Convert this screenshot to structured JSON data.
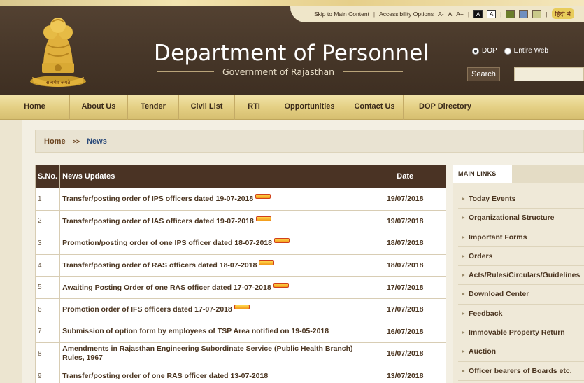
{
  "utility": {
    "skip_link": "Skip to Main Content",
    "accessibility": "Accessibility Options",
    "font_small": "A-",
    "font_normal": "A",
    "font_large": "A+",
    "contrast_dark": "A",
    "contrast_light": "A",
    "swatches": [
      "#6b7d2a",
      "#6f8fbf",
      "#c9c98a"
    ],
    "hindi": "हिंदी में"
  },
  "header": {
    "title": "Department of Personnel",
    "subtitle": "Government of Rajasthan",
    "emblem_motto": "सत्यमेव जयते"
  },
  "search": {
    "option_dop": "DOP",
    "option_web": "Entire Web",
    "button": "Search",
    "value": ""
  },
  "nav": [
    {
      "label": "Home"
    },
    {
      "label": "About Us"
    },
    {
      "label": "Tender"
    },
    {
      "label": "Civil List"
    },
    {
      "label": "RTI"
    },
    {
      "label": "Opportunities"
    },
    {
      "label": "Contact Us"
    },
    {
      "label": "DOP Directory"
    }
  ],
  "breadcrumb": {
    "home": "Home",
    "sep": ">>",
    "current": "News"
  },
  "table": {
    "headers": {
      "sno": "S.No.",
      "title": "News Updates",
      "date": "Date"
    },
    "rows": [
      {
        "sno": "1",
        "title": "Transfer/posting order of IPS officers dated 19-07-2018",
        "date": "19/07/2018",
        "new": true
      },
      {
        "sno": "2",
        "title": "Transfer/posting order of IAS officers dated 19-07-2018",
        "date": "19/07/2018",
        "new": true
      },
      {
        "sno": "3",
        "title": "Promotion/posting order of one IPS officer dated 18-07-2018",
        "date": "18/07/2018",
        "new": true
      },
      {
        "sno": "4",
        "title": "Transfer/posting order of RAS officers dated 18-07-2018",
        "date": "18/07/2018",
        "new": true
      },
      {
        "sno": "5",
        "title": "Awaiting Posting Order of one RAS officer dated 17-07-2018",
        "date": "17/07/2018",
        "new": true
      },
      {
        "sno": "6",
        "title": "Promotion order of IFS officers dated 17-07-2018",
        "date": "17/07/2018",
        "new": true
      },
      {
        "sno": "7",
        "title": "Submission of option form by employees of TSP Area notified on 19-05-2018",
        "date": "16/07/2018",
        "new": false
      },
      {
        "sno": "8",
        "title": "Amendments in Rajasthan Engineering Subordinate Service (Public Health Branch) Rules, 1967",
        "date": "16/07/2018",
        "new": false
      },
      {
        "sno": "9",
        "title": "Transfer/posting order of one RAS officer dated 13-07-2018",
        "date": "13/07/2018",
        "new": false
      }
    ]
  },
  "side": {
    "tab": "MAIN LINKS",
    "links": [
      "Today Events",
      "Organizational Structure",
      "Important Forms",
      "Orders",
      "Acts/Rules/Circulars/Guidelines",
      "Download Center",
      "Feedback",
      "Immovable Property Return",
      "Auction",
      "Officer bearers of Boards etc."
    ]
  }
}
